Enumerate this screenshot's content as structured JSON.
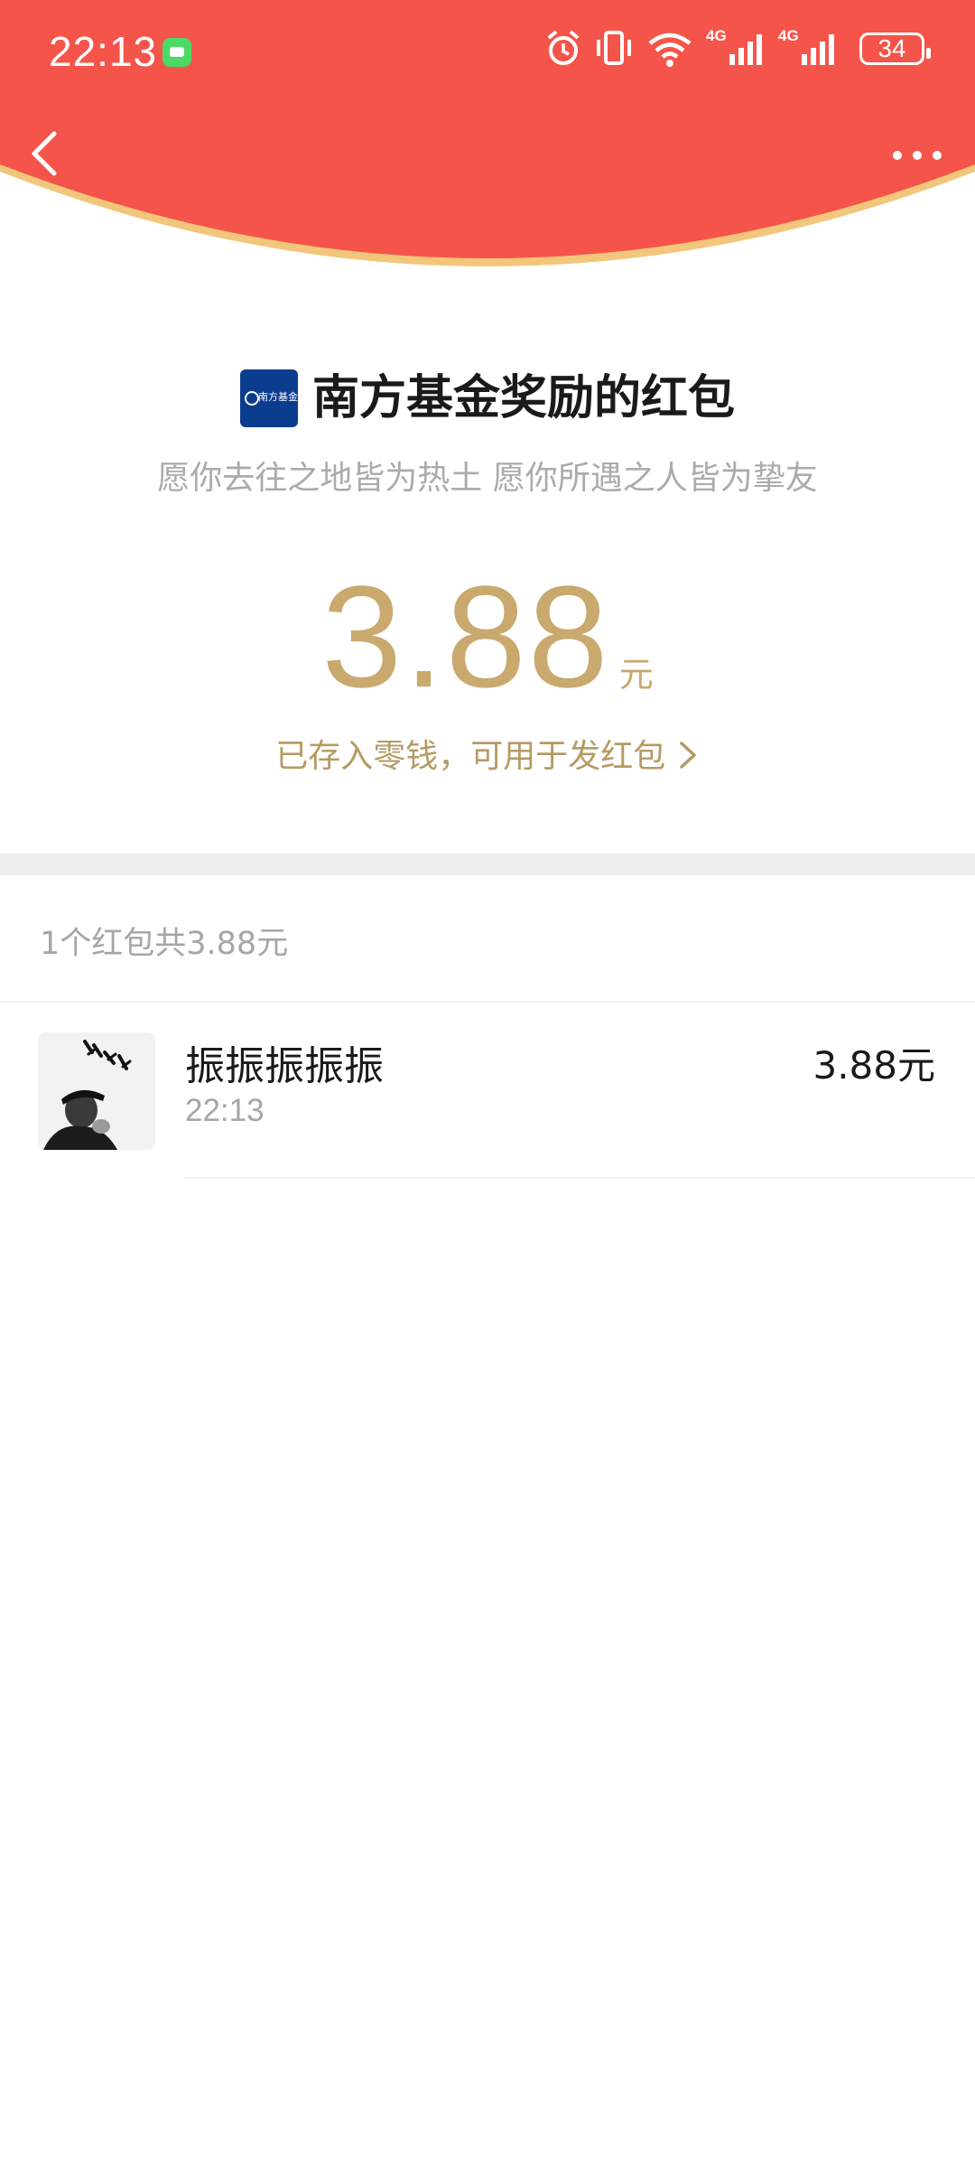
{
  "status_bar": {
    "time": "22:13",
    "network_label_1": "4G",
    "network_label_2": "4G",
    "battery_level": "34"
  },
  "header": {
    "background_color": "#f5544a",
    "rim_color": "#f2c77b"
  },
  "sender": {
    "name": "南方基金奖励的红包",
    "logo_text": "南方基金",
    "greeting": "愿你去往之地皆为热土 愿你所遇之人皆为挚友"
  },
  "amount": {
    "value": "3.88",
    "unit": "元",
    "deposit_text": "已存入零钱，可用于发红包",
    "accent_color": "#c9a96e"
  },
  "summary": {
    "text": "1个红包共3.88元"
  },
  "records": [
    {
      "name": "振振振振振",
      "time": "22:13",
      "amount": "3.88元"
    }
  ]
}
